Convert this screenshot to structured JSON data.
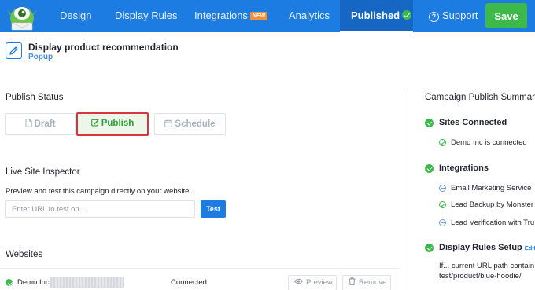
{
  "nav": {
    "tabs": [
      {
        "label": "Design"
      },
      {
        "label": "Display Rules"
      },
      {
        "label": "Integrations",
        "badge": "NEW"
      },
      {
        "label": "Analytics"
      },
      {
        "label": "Published"
      },
      {
        "label": "Support"
      }
    ],
    "save_label": "Save"
  },
  "campaign": {
    "title": "Display product recommendation",
    "type": "Popup"
  },
  "publish_status": {
    "heading": "Publish Status",
    "buttons": [
      {
        "label": "Draft",
        "icon": "document-icon"
      },
      {
        "label": "Publish",
        "icon": "checkbox-icon",
        "selected": true
      },
      {
        "label": "Schedule",
        "icon": "calendar-icon"
      }
    ]
  },
  "inspector": {
    "heading": "Live Site Inspector",
    "description": "Preview and test this campaign directly on your website.",
    "url_placeholder": "Enter URL to test on...",
    "test_label": "Test"
  },
  "websites": {
    "heading": "Websites",
    "rows": [
      {
        "name": "Demo Inc",
        "status": "Connected",
        "preview_label": "Preview",
        "remove_label": "Remove"
      }
    ]
  },
  "summary": {
    "heading": "Campaign Publish Summary",
    "sites": {
      "heading": "Sites Connected",
      "items": [
        "Demo Inc is connected"
      ]
    },
    "integrations": {
      "heading": "Integrations",
      "items": [
        "Email Marketing Service",
        "Lead Backup by Monster",
        "Lead Verification with Tru"
      ]
    },
    "display_rules": {
      "heading": "Display Rules Setup",
      "edit_label": "Edit",
      "line1": "If... current URL path contain",
      "line2": "test/product/blue-hoodie/"
    }
  },
  "colors": {
    "nav_bg": "#1c7ce1",
    "nav_active_bg": "#1666c4",
    "save_green": "#3cb94a",
    "new_badge": "#f2913d",
    "publish_selected_border": "#d93540"
  }
}
